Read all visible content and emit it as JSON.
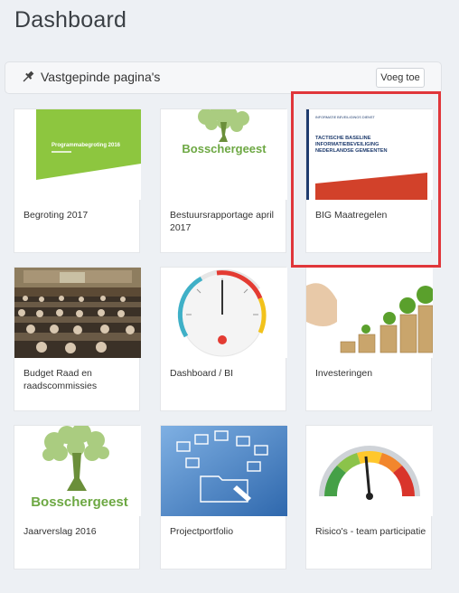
{
  "header": {
    "title": "Dashboard"
  },
  "pinned": {
    "title": "Vastgepinde pagina's",
    "add_label": "Voeg toe"
  },
  "tiles": [
    {
      "label": "Begroting 2017",
      "thumb_title": "Programmabegroting 2016"
    },
    {
      "label": "Bestuursrapportage april 2017",
      "thumb_brand": "Bosschergeest"
    },
    {
      "label": "BIG Maatregelen",
      "thumb_header": "INFORMATIE BEVEILIGINGS DIENST",
      "thumb_line1": "TACTISCHE BASELINE",
      "thumb_line2": "INFORMATIEBEVEILIGING",
      "thumb_line3": "NEDERLANDSE GEMEENTEN"
    },
    {
      "label": "Budget Raad en raadscommissies"
    },
    {
      "label": "Dashboard / BI"
    },
    {
      "label": "Investeringen"
    },
    {
      "label": "Jaarverslag 2016",
      "thumb_brand": "Bosschergeest"
    },
    {
      "label": "Projectportfolio"
    },
    {
      "label": "Risico's - team participatie"
    }
  ],
  "colors": {
    "accent_green": "#8dc63f",
    "highlight_red": "#e0363a",
    "brand_green": "#6da843"
  }
}
